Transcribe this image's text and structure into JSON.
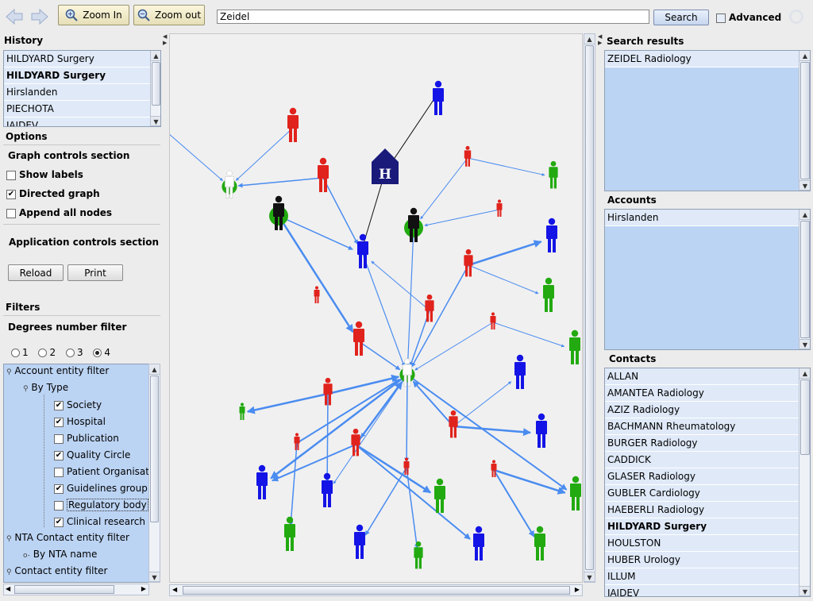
{
  "toolbar": {
    "zoom_in_label": "Zoom In",
    "zoom_out_label": "Zoom out",
    "search_value": "Zeidel",
    "search_button": "Search",
    "advanced_label": "Advanced"
  },
  "history": {
    "title": "History",
    "items": [
      "HILDYARD Surgery",
      "HILDYARD Surgery",
      "Hirslanden",
      "PIECHOTA",
      "JAIDEV"
    ]
  },
  "options": {
    "title": "Options",
    "graph_controls_title": "Graph controls section",
    "show_labels": "Show labels",
    "show_labels_checked": false,
    "directed_graph": "Directed graph",
    "directed_graph_checked": true,
    "append_all_nodes": "Append all nodes",
    "append_all_nodes_checked": false,
    "app_controls_title": "Application controls section",
    "reload_label": "Reload",
    "print_label": "Print"
  },
  "filters": {
    "title": "Filters",
    "degrees_title": "Degrees number filter",
    "degrees": [
      "1",
      "2",
      "3",
      "4"
    ],
    "degrees_selected": "4",
    "tree": {
      "account_filter": "Account entity filter",
      "by_type": "By Type",
      "types": [
        {
          "label": "Society",
          "checked": true
        },
        {
          "label": "Hospital",
          "checked": true
        },
        {
          "label": "Publication",
          "checked": false
        },
        {
          "label": "Quality Circle",
          "checked": true
        },
        {
          "label": "Patient Organisation",
          "checked": false
        },
        {
          "label": "Guidelines group",
          "checked": true
        },
        {
          "label": "Regulatory body",
          "checked": false
        },
        {
          "label": "Clinical research group",
          "checked": true
        }
      ],
      "nta_filter": "NTA Contact entity filter",
      "by_nta_name": "By NTA name",
      "contact_filter": "Contact entity filter"
    }
  },
  "search_results": {
    "title": "Search results",
    "items": [
      "ZEIDEL Radiology"
    ]
  },
  "accounts": {
    "title": "Accounts",
    "items": [
      "Hirslanden"
    ]
  },
  "contacts": {
    "title": "Contacts",
    "items": [
      "ALLAN",
      "AMANTEA Radiology",
      "AZIZ Radiology",
      "BACHMANN Rheumatology",
      "BURGER Radiology",
      "CADDICK",
      "GLASER Radiology",
      "GUBLER Cardiology",
      "HAEBERLI Radiology",
      "HILDYARD Surgery",
      "HOULSTON",
      "HUBER Urology",
      "ILLUM",
      "JAIDEV"
    ]
  },
  "colors": {
    "edge": "#4a8cf0",
    "red_node": "#e0231c",
    "blue_node": "#1414e6",
    "green_node": "#22aa10",
    "black_node": "#111111",
    "hospital": "#1a1a7a"
  },
  "graph": {
    "hospital_icon_letter": "H"
  }
}
